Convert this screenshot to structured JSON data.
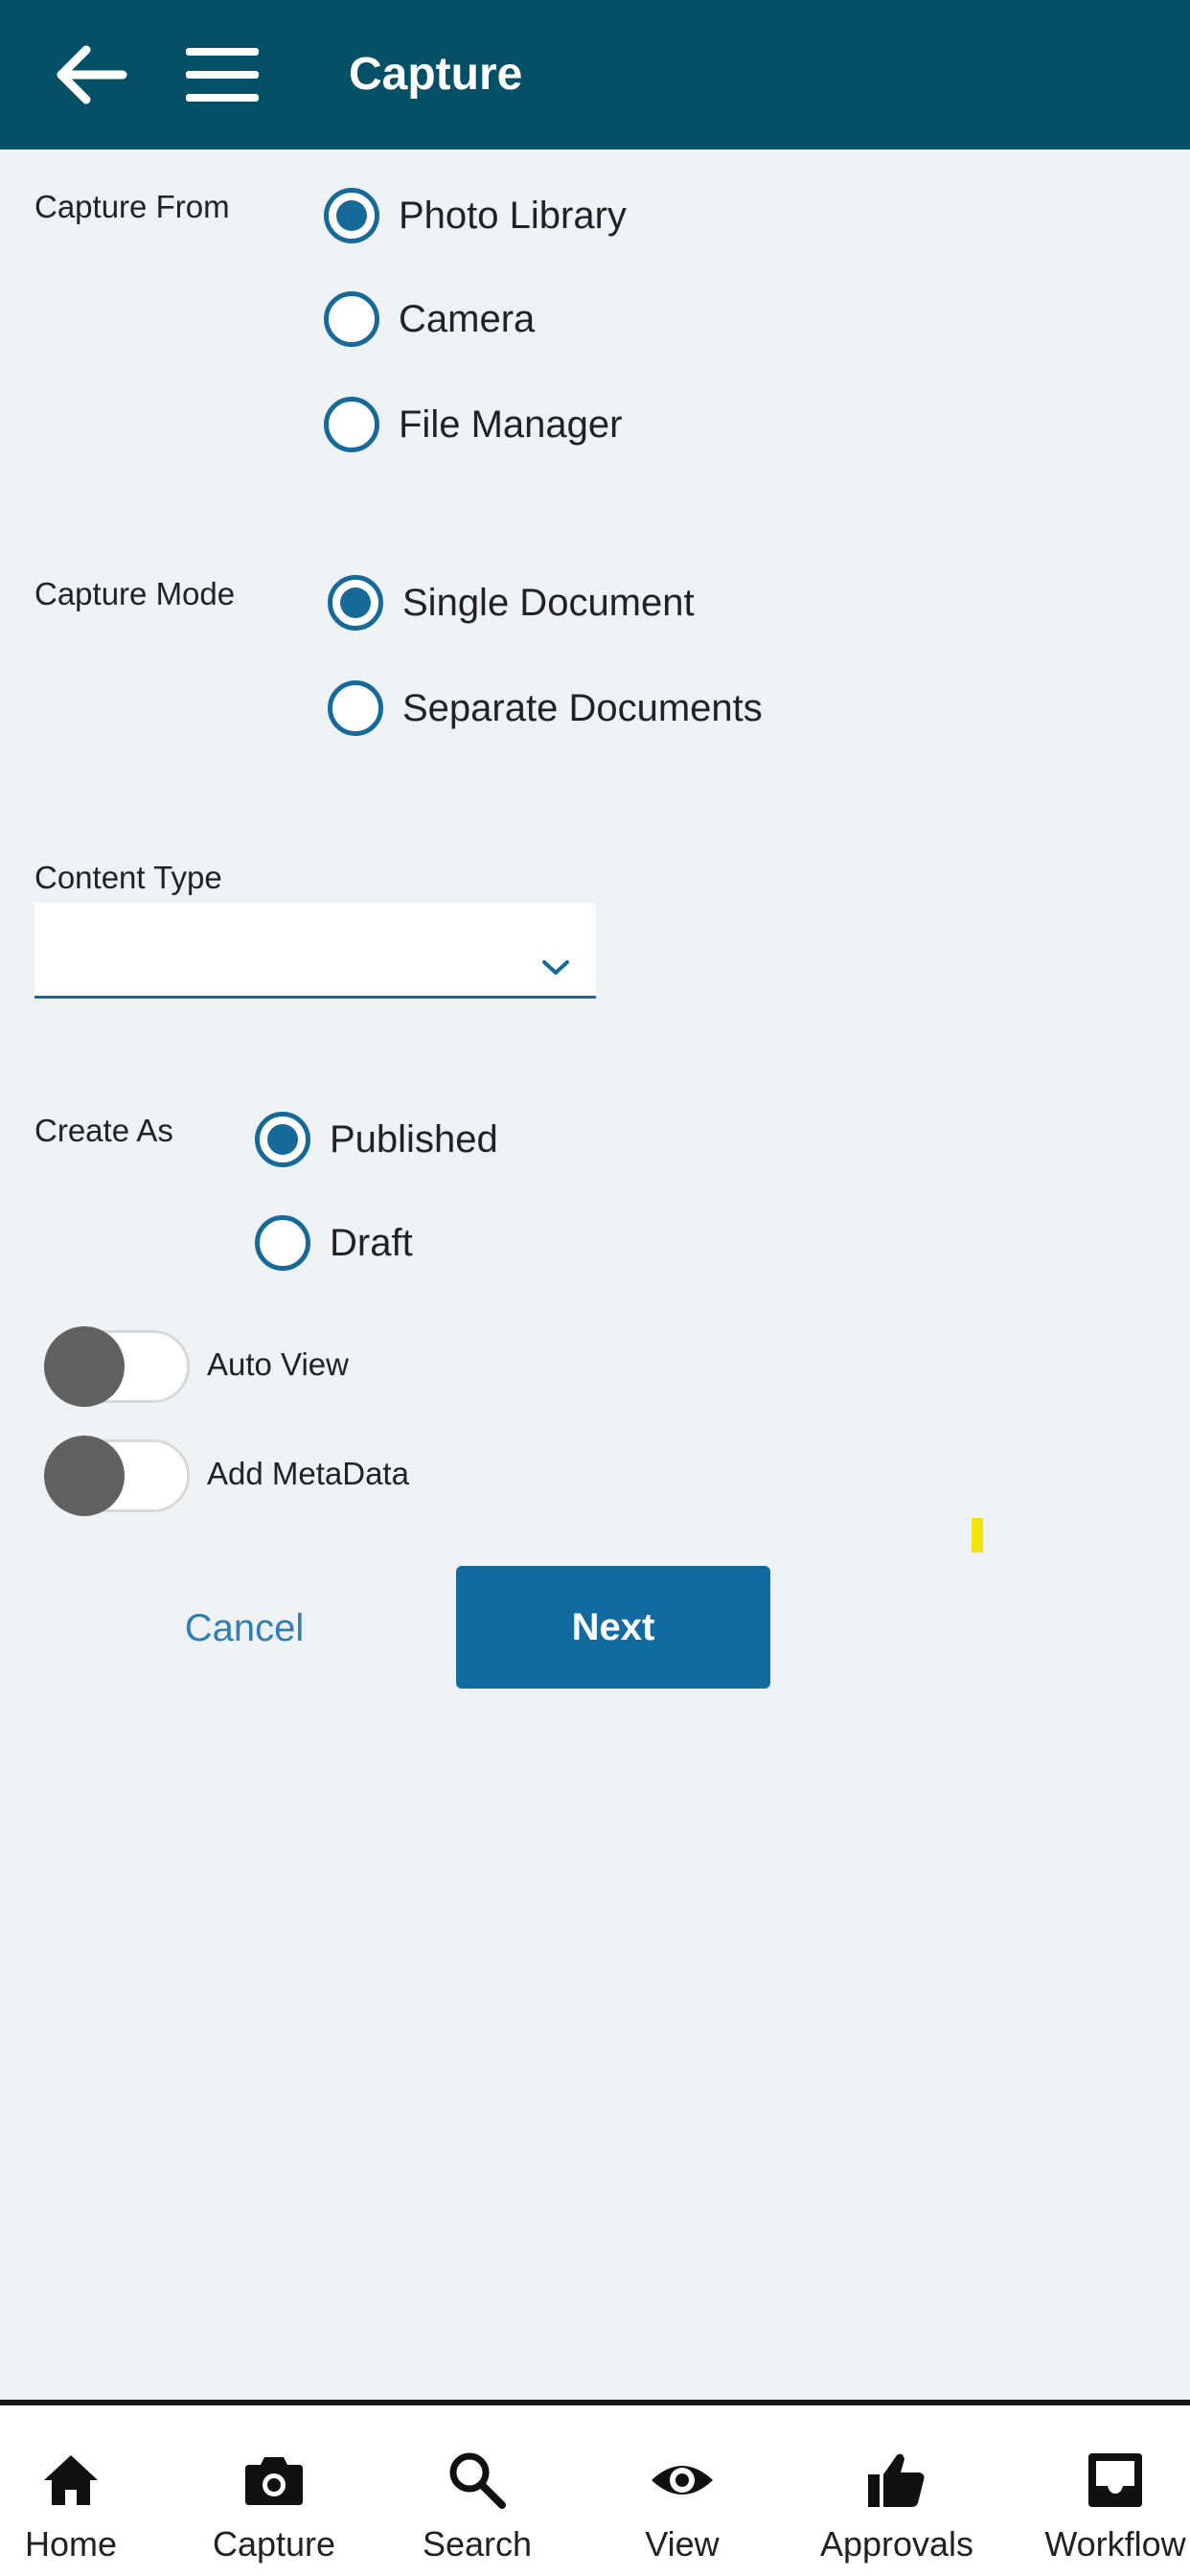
{
  "header": {
    "title": "Capture",
    "back_icon": "arrow-left-icon",
    "menu_icon": "hamburger-menu-icon",
    "background": "#045066"
  },
  "capture_from": {
    "label": "Capture From",
    "options": [
      {
        "label": "Photo Library",
        "selected": true
      },
      {
        "label": "Camera",
        "selected": false
      },
      {
        "label": "File Manager",
        "selected": false
      }
    ]
  },
  "capture_mode": {
    "label": "Capture Mode",
    "options": [
      {
        "label": "Single Document",
        "selected": true
      },
      {
        "label": "Separate Documents",
        "selected": false
      }
    ]
  },
  "content_type": {
    "label": "Content Type",
    "value": ""
  },
  "create_as": {
    "label": "Create As",
    "options": [
      {
        "label": "Published",
        "selected": true
      },
      {
        "label": "Draft",
        "selected": false
      }
    ]
  },
  "toggles": {
    "auto_view": {
      "label": "Auto View",
      "on": false
    },
    "add_metadata": {
      "label": "Add MetaData",
      "on": false
    }
  },
  "actions": {
    "cancel_label": "Cancel",
    "next_label": "Next"
  },
  "bottom_nav": {
    "items": [
      {
        "label": "Home",
        "icon": "home-icon"
      },
      {
        "label": "Capture",
        "icon": "camera-icon"
      },
      {
        "label": "Search",
        "icon": "search-icon"
      },
      {
        "label": "View",
        "icon": "eye-icon"
      },
      {
        "label": "Approvals",
        "icon": "thumbs-up-icon"
      },
      {
        "label": "Workflow",
        "icon": "inbox-icon"
      }
    ]
  },
  "colors": {
    "accent": "#166a99",
    "primary_button": "#116ba0",
    "link": "#2f7eb6",
    "background": "#eff2f5"
  }
}
